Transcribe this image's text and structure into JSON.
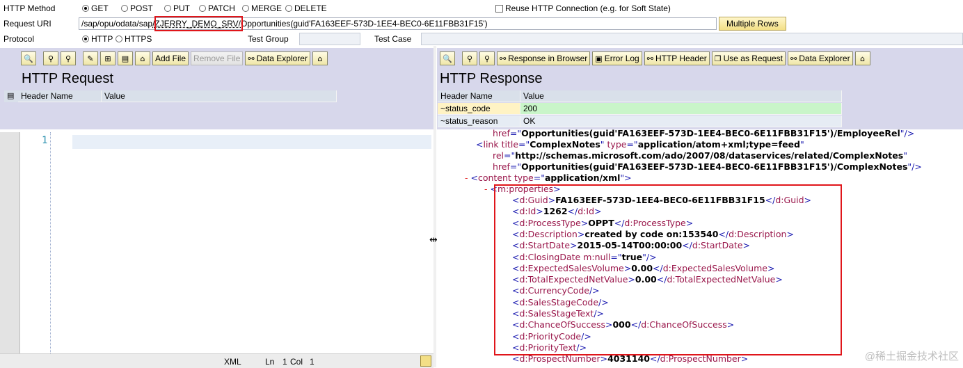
{
  "form": {
    "http_method_label": "HTTP Method",
    "methods": [
      {
        "label": "GET",
        "selected": true
      },
      {
        "label": "POST",
        "selected": false
      },
      {
        "label": "PUT",
        "selected": false
      },
      {
        "label": "PATCH",
        "selected": false
      },
      {
        "label": "MERGE",
        "selected": false
      },
      {
        "label": "DELETE",
        "selected": false
      }
    ],
    "reuse_label": "Reuse HTTP Connection (e.g. for Soft State)",
    "reuse_checked": false,
    "request_uri_label": "Request URI",
    "request_uri_value": "/sap/opu/odata/sap/ZJERRY_DEMO_SRV/Opportunities(guid'FA163EEF-573D-1EE4-BEC0-6E11FBB31F15')",
    "uri_part1": "/sap/opu/odata/sap",
    "uri_part2": "/ZJERRY_DEMO_SRV/",
    "uri_part3": "Opportunities(guid'FA163EEF-573D-1EE4-BEC0-6E11FBB31F15')",
    "multiple_rows_label": "Multiple Rows",
    "protocol_label": "Protocol",
    "protocols": [
      {
        "label": "HTTP",
        "selected": true
      },
      {
        "label": "HTTPS",
        "selected": false
      }
    ],
    "test_group_label": "Test Group",
    "test_group_value": "",
    "test_case_label": "Test Case",
    "test_case_value": ""
  },
  "request": {
    "title": "HTTP Request",
    "toolbar": {
      "add_file": "Add File",
      "remove_file": "Remove File",
      "data_explorer": "Data Explorer"
    },
    "columns": [
      "Header Name",
      "Value"
    ],
    "editor_line_number": "1"
  },
  "response": {
    "title": "HTTP Response",
    "toolbar": {
      "response_in_browser": "Response in Browser",
      "error_log": "Error Log",
      "http_header": "HTTP Header",
      "use_as_request": "Use as Request",
      "data_explorer": "Data Explorer"
    },
    "columns": [
      "Header Name",
      "Value"
    ],
    "rows": [
      {
        "name": "~status_code",
        "value": "200"
      },
      {
        "name": "~status_reason",
        "value": "OK"
      }
    ]
  },
  "statusbar": {
    "format": "XML",
    "ln_label": "Ln",
    "ln_value": "1",
    "col_label": "Col",
    "col_value": "1"
  },
  "xml": {
    "l0_attr": "href",
    "l0_value": "Opportunities(guid'FA163EEF-573D-1EE4-BEC0-6E11FBB31F15')/EmployeeRel",
    "l1_tag": "link",
    "l1_title_val": "ComplexNotes",
    "l1_type_val": "application/atom+xml;type=feed",
    "l2_rel_val": "http://schemas.microsoft.com/ado/2007/08/dataservices/related/ComplexNotes",
    "l3_href_val": "Opportunities(guid'FA163EEF-573D-1EE4-BEC0-6E11FBB31F15')/ComplexNotes",
    "l4_tag": "content",
    "l4_type_val": "application/xml",
    "l5_tag": "m:properties",
    "props": [
      {
        "tag": "d:Guid",
        "value": "FA163EEF-573D-1EE4-BEC0-6E11FBB31F15"
      },
      {
        "tag": "d:Id",
        "value": "1262"
      },
      {
        "tag": "d:ProcessType",
        "value": "OPPT"
      },
      {
        "tag": "d:Description",
        "value": "created by code on:153540"
      },
      {
        "tag": "d:StartDate",
        "value": "2015-05-14T00:00:00"
      },
      {
        "tag": "d:ClosingDate",
        "null_attr": "m:null",
        "null_val": "true"
      },
      {
        "tag": "d:ExpectedSalesVolume",
        "value": "0.00"
      },
      {
        "tag": "d:TotalExpectedNetValue",
        "value": "0.00"
      },
      {
        "tag": "d:CurrencyCode"
      },
      {
        "tag": "d:SalesStageCode"
      },
      {
        "tag": "d:SalesStageText"
      },
      {
        "tag": "d:ChanceOfSuccess",
        "value": "000"
      },
      {
        "tag": "d:PriorityCode"
      },
      {
        "tag": "d:PriorityText"
      },
      {
        "tag": "d:ProspectNumber",
        "value": "4031140"
      }
    ]
  },
  "watermark": "@稀土掘金技术社区",
  "colors": {
    "pane_header_bg": "#d7d7eb",
    "highlight_red": "#e0151a",
    "status_code_bg": "#fff3c4",
    "status_value_bg": "#c9f5c9"
  }
}
